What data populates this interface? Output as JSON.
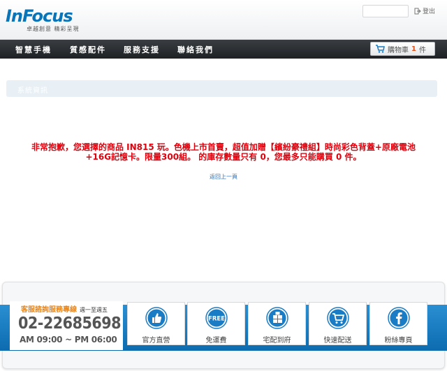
{
  "header": {
    "logo_text": "InFocus",
    "tagline": "卓越創意 精彩呈現",
    "logout_label": "登出"
  },
  "nav": {
    "items": [
      "智慧手機",
      "質感配件",
      "服務支援",
      "聯絡我們"
    ],
    "cart_label": "購物車",
    "cart_count": "1",
    "cart_unit": "件"
  },
  "main": {
    "sys_title": "系統資訊",
    "error_line1": "非常抱歉，您選擇的商品 IN815 玩。色機上市首賣，超值加贈【繽紛豪禮組】時尚彩色背蓋+原廠電池",
    "error_line2": "+16G記憶卡。限量300組。 的庫存數量只有 0，您最多只能購買 0 件。",
    "back_label": "返回上一頁"
  },
  "footer": {
    "contact_title": "客服諮詢服務專線",
    "contact_days": "週一至週五",
    "phone": "02-22685698",
    "hours": "AM 09:00 ~ PM 06:00",
    "services": [
      {
        "label": "官方直營",
        "icon": "thumbs-up-icon"
      },
      {
        "label": "免運費",
        "icon": "free-icon"
      },
      {
        "label": "宅配到府",
        "icon": "box-icon"
      },
      {
        "label": "快速配送",
        "icon": "cart-icon"
      },
      {
        "label": "粉絲專頁",
        "icon": "facebook-icon"
      }
    ]
  },
  "colors": {
    "brand": "#0a74b8",
    "error": "#e0000c",
    "accent": "#e8861c",
    "band": "#1a7cc4"
  }
}
